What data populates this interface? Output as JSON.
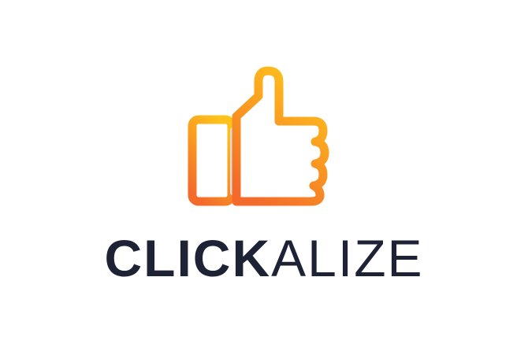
{
  "logo": {
    "icon": "thumbs-up-icon",
    "gradient_start": "#FFC21A",
    "gradient_end": "#F36A2A",
    "shadow_color": "#D9D9D9"
  },
  "wordmark": {
    "bold_text": "CLICK",
    "light_text": "ALIZE",
    "color": "#1E2235"
  },
  "background": "#FFFFFF"
}
